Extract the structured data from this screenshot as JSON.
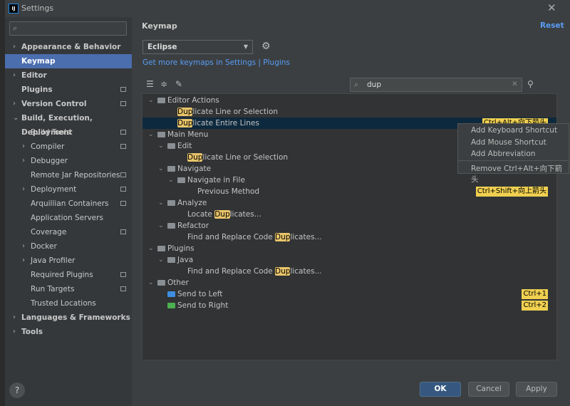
{
  "window": {
    "title": "Settings",
    "close": "✕"
  },
  "sidebar": {
    "search_placeholder": "",
    "items": [
      {
        "label": "Appearance & Behavior",
        "arrow": "›",
        "level": 0,
        "badge": false
      },
      {
        "label": "Keymap",
        "arrow": "",
        "level": 0,
        "badge": false,
        "selected": true
      },
      {
        "label": "Editor",
        "arrow": "›",
        "level": 0,
        "badge": false
      },
      {
        "label": "Plugins",
        "arrow": "",
        "level": 0,
        "badge": true
      },
      {
        "label": "Version Control",
        "arrow": "›",
        "level": 0,
        "badge": true
      },
      {
        "label": "Build, Execution, Deployment",
        "arrow": "⌄",
        "level": 0,
        "badge": false
      },
      {
        "label": "Build Tools",
        "arrow": "›",
        "level": 1,
        "badge": true
      },
      {
        "label": "Compiler",
        "arrow": "›",
        "level": 1,
        "badge": true
      },
      {
        "label": "Debugger",
        "arrow": "›",
        "level": 1,
        "badge": false
      },
      {
        "label": "Remote Jar Repositories",
        "arrow": "",
        "level": 1,
        "badge": true
      },
      {
        "label": "Deployment",
        "arrow": "›",
        "level": 1,
        "badge": true
      },
      {
        "label": "Arquillian Containers",
        "arrow": "",
        "level": 1,
        "badge": true
      },
      {
        "label": "Application Servers",
        "arrow": "",
        "level": 1,
        "badge": false
      },
      {
        "label": "Coverage",
        "arrow": "",
        "level": 1,
        "badge": true
      },
      {
        "label": "Docker",
        "arrow": "›",
        "level": 1,
        "badge": false
      },
      {
        "label": "Java Profiler",
        "arrow": "›",
        "level": 1,
        "badge": false
      },
      {
        "label": "Required Plugins",
        "arrow": "",
        "level": 1,
        "badge": true
      },
      {
        "label": "Run Targets",
        "arrow": "",
        "level": 1,
        "badge": true
      },
      {
        "label": "Trusted Locations",
        "arrow": "",
        "level": 1,
        "badge": false
      },
      {
        "label": "Languages & Frameworks",
        "arrow": "›",
        "level": 0,
        "badge": false
      },
      {
        "label": "Tools",
        "arrow": "›",
        "level": 0,
        "badge": false
      }
    ]
  },
  "main": {
    "title": "Keymap",
    "reset": "Reset",
    "scheme": "Eclipse",
    "get_more": "Get more keymaps in Settings | Plugins",
    "filter_value": "dup"
  },
  "tree": [
    {
      "level": 0,
      "arrow": "⌄",
      "icon": "folder",
      "pre": "",
      "hl": "",
      "post": "Editor Actions",
      "sc": ""
    },
    {
      "level": 1,
      "arrow": "",
      "icon": "",
      "pre": "",
      "hl": "Dup",
      "post": "licate Line or Selection",
      "sc": ""
    },
    {
      "level": 1,
      "arrow": "",
      "icon": "",
      "pre": "",
      "hl": "Dup",
      "post": "licate Entire Lines",
      "sc": "Ctrl+Alt+向下箭头",
      "selected": true
    },
    {
      "level": 0,
      "arrow": "⌄",
      "icon": "folder",
      "pre": "",
      "hl": "",
      "post": "Main Menu",
      "sc": ""
    },
    {
      "level": 1,
      "arrow": "⌄",
      "icon": "folder",
      "pre": "",
      "hl": "",
      "post": "Edit",
      "sc": ""
    },
    {
      "level": 2,
      "arrow": "",
      "icon": "",
      "pre": "",
      "hl": "Dup",
      "post": "licate Line or Selection",
      "sc": ""
    },
    {
      "level": 1,
      "arrow": "⌄",
      "icon": "folder",
      "pre": "",
      "hl": "",
      "post": "Navigate",
      "sc": ""
    },
    {
      "level": 2,
      "arrow": "⌄",
      "icon": "folder",
      "pre": "",
      "hl": "",
      "post": "Navigate in File",
      "sc": ""
    },
    {
      "level": 3,
      "arrow": "",
      "icon": "",
      "pre": "",
      "hl": "",
      "post": "Previous Method",
      "sc": "Ctrl+Shift+向上箭头"
    },
    {
      "level": 1,
      "arrow": "⌄",
      "icon": "folder",
      "pre": "",
      "hl": "",
      "post": "Analyze",
      "sc": ""
    },
    {
      "level": 2,
      "arrow": "",
      "icon": "",
      "pre": "Locate ",
      "hl": "Dup",
      "post": "licates...",
      "sc": ""
    },
    {
      "level": 1,
      "arrow": "⌄",
      "icon": "folder",
      "pre": "",
      "hl": "",
      "post": "Refactor",
      "sc": ""
    },
    {
      "level": 2,
      "arrow": "",
      "icon": "",
      "pre": "Find and Replace Code ",
      "hl": "Dup",
      "post": "licates...",
      "sc": ""
    },
    {
      "level": 0,
      "arrow": "⌄",
      "icon": "folder",
      "pre": "",
      "hl": "",
      "post": "Plugins",
      "sc": ""
    },
    {
      "level": 1,
      "arrow": "⌄",
      "icon": "folder",
      "pre": "",
      "hl": "",
      "post": "Java",
      "sc": ""
    },
    {
      "level": 2,
      "arrow": "",
      "icon": "",
      "pre": "Find and Replace Code ",
      "hl": "Dup",
      "post": "licates...",
      "sc": ""
    },
    {
      "level": 0,
      "arrow": "⌄",
      "icon": "folder",
      "pre": "",
      "hl": "",
      "post": "Other",
      "sc": ""
    },
    {
      "level": 1,
      "arrow": "",
      "icon": "send-left",
      "pre": "",
      "hl": "",
      "post": "Send to Left",
      "sc": "Ctrl+1"
    },
    {
      "level": 1,
      "arrow": "",
      "icon": "send-right",
      "pre": "",
      "hl": "",
      "post": "Send to Right",
      "sc": "Ctrl+2"
    }
  ],
  "context_menu": [
    "Add Keyboard Shortcut",
    "Add Mouse Shortcut",
    "Add Abbreviation",
    "Remove Ctrl+Alt+向下箭头"
  ],
  "buttons": {
    "ok": "OK",
    "cancel": "Cancel",
    "apply": "Apply",
    "help": "?"
  },
  "colors": {
    "accent": "#4b6eaf",
    "link": "#589df6",
    "highlight": "#e8c46a",
    "ok": "#365880"
  }
}
